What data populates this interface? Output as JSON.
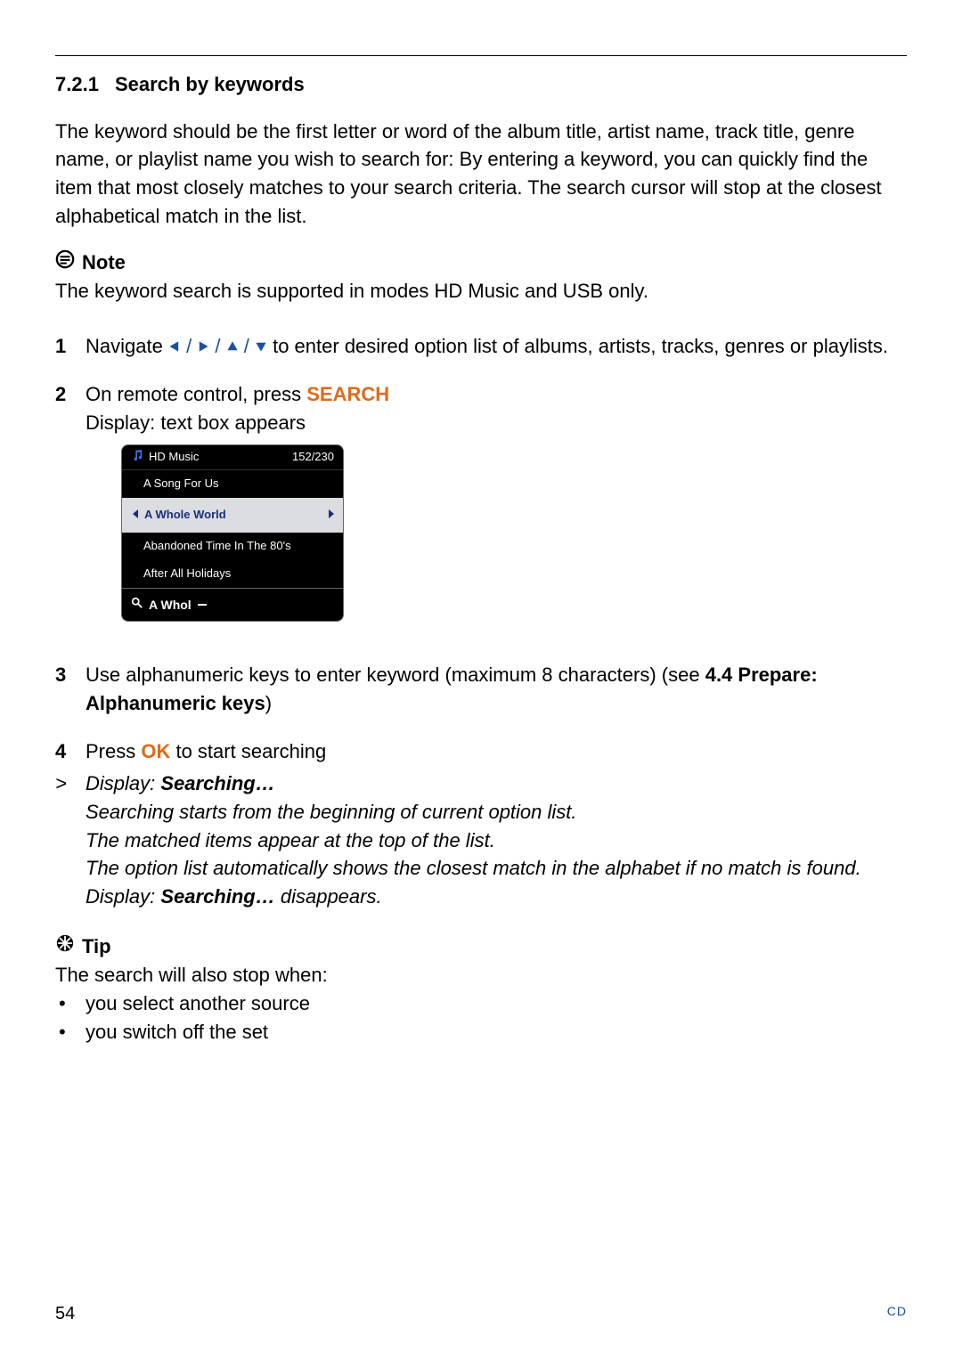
{
  "section": {
    "number": "7.2.1",
    "title": "Search by keywords"
  },
  "intro": "The keyword should be the first letter or word of the album title, artist name, track title, genre name, or playlist name you wish to search for: By entering a keyword, you can quickly find the item that most closely matches to your search criteria. The search cursor will stop at the closest alphabetical match in the list.",
  "note": {
    "label": "Note",
    "text": "The keyword search is supported in modes HD Music and USB only."
  },
  "steps": {
    "s1_head": "Navigate ",
    "s1_tail": " to enter desired option list of albums, artists, tracks, genres or playlists.",
    "s2_a": "On remote control, press ",
    "s2_key": "SEARCH",
    "s2_b": "Display: text box appears",
    "s3_a": "Use alphanumeric keys to enter keyword (maximum 8 characters) (see ",
    "s3_bold": "4.4 Prepare: Alphanumeric keys",
    "s3_close": ")",
    "s4_a": "Press ",
    "s4_key": "OK",
    "s4_b": " to start searching"
  },
  "result": {
    "l1a": "Display: ",
    "l1b": "Searching…",
    "l2": "Searching starts from the beginning of current option list.",
    "l3": "The matched items appear at the top of the list.",
    "l4": "The option list automatically shows the closest match in the alphabet if no match is found.",
    "l5a": "Display: ",
    "l5b": "Searching…",
    "l5c": " disappears."
  },
  "tip": {
    "label": "Tip",
    "lead": "The search will also stop when:",
    "b1": "you select another source",
    "b2": "you switch off the set"
  },
  "device": {
    "title": "HD Music",
    "counter": "152/230",
    "items": [
      "A Song For Us",
      "A Whole World",
      "Abandoned Time In The 80's",
      "After All Holidays"
    ],
    "search_typed": "A Whol"
  },
  "footer": {
    "page": "54",
    "section_ref": "CD"
  }
}
